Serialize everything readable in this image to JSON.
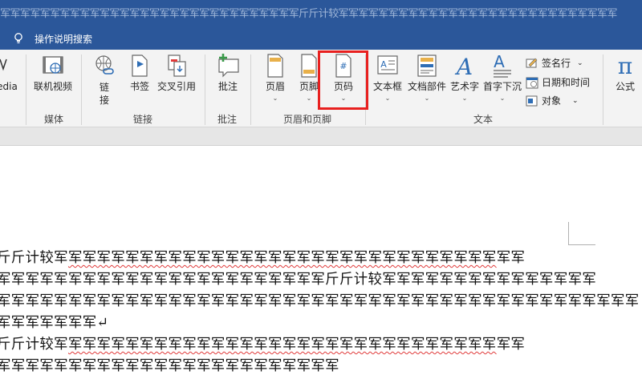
{
  "titlebar": {
    "text": "军军军军军军军军军军军军军军军军军军军军军军军军军军军军军军斤斤计较军军军军军军军军军军军军军军军军军军军军军军军军军军军军"
  },
  "tellme": {
    "text": "操作说明搜索"
  },
  "ribbon": {
    "partial_left": {
      "label": "edia"
    },
    "buttons": {
      "online_video": "联机视频",
      "link": "链\n接",
      "bookmark": "书签",
      "cross_ref": "交叉引用",
      "comment": "批注",
      "header": "页眉",
      "footer": "页脚",
      "page_number": "页码",
      "textbox": "文本框",
      "quick_parts": "文档部件",
      "wordart": "艺术字",
      "dropcap": "首字下沉",
      "signature": "签名行",
      "datetime": "日期和时间",
      "object": "对象",
      "equation": "公式"
    },
    "groups": {
      "media": "媒体",
      "links": "链接",
      "comments": "批注",
      "header_footer": "页眉和页脚",
      "text": "文本"
    }
  },
  "document": {
    "lines": [
      {
        "prefix": "斤斤计较军",
        "squiggle": "军军军军军军军军军军军军军军军军军军军军军军军军军军军军军军",
        "suffix": "军军"
      },
      {
        "prefix": "军军军军军军军军军军军军军军军军军军军军军军军斤斤计较军军军军军军军军军军军军军军军",
        "squiggle": "",
        "suffix": ""
      },
      {
        "prefix": "军军军军军军军军军军军军军军军军军军军军军军军军军军军军军军军军军军军军军军军军军军军军军",
        "squiggle": "",
        "suffix": ""
      },
      {
        "prefix": "军军军军军军军↵",
        "squiggle": "",
        "suffix": ""
      },
      {
        "prefix": "斤斤计较军",
        "squiggle": "军军军军军军军军军军军军军军军军军军军军军军军军军军军军军军",
        "suffix": "军军"
      },
      {
        "prefix": "军军军军军军军军军军军军军军军军军军军军军军军军",
        "squiggle": "",
        "suffix": ""
      }
    ]
  },
  "colors": {
    "title_blue": "#2b579a",
    "highlight_red": "#e8201f",
    "ribbon_bg": "#f3f3f3",
    "icon_blue": "#2e6db5"
  }
}
